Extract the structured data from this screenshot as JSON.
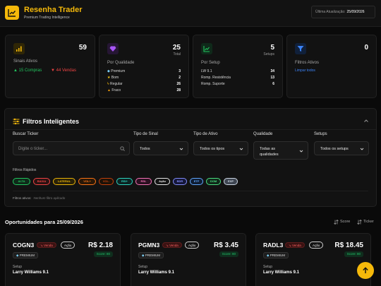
{
  "header": {
    "title": "Resenha Trader",
    "subtitle": "Premium Trading Intelligence",
    "update_label": "Última Atualização:",
    "update_date": "25/09/2026"
  },
  "stats": {
    "signals": {
      "value": "59",
      "title": "Sinais Ativos",
      "buys": "15 Compras",
      "sells": "44 Vendas",
      "icon": "bar-chart-icon"
    },
    "quality": {
      "value": "25",
      "unit": "Total",
      "title": "Por Qualidade",
      "rows": [
        {
          "label": "Premium",
          "count": "3",
          "icon": "gem-icon"
        },
        {
          "label": "Bom",
          "count": "2",
          "icon": "star-icon"
        },
        {
          "label": "Regular",
          "count": "26",
          "icon": "bolt-icon"
        },
        {
          "label": "Fraco",
          "count": "28",
          "icon": "warning-icon"
        }
      ]
    },
    "setup": {
      "value": "5",
      "unit": "Setups",
      "title": "Por Setup",
      "rows": [
        {
          "label": "LW 9.1",
          "count": "34"
        },
        {
          "label": "Romp. Resistência",
          "count": "13"
        },
        {
          "label": "Romp. Suporte",
          "count": "6"
        }
      ]
    },
    "filters": {
      "value": "0",
      "title": "Filtros Ativos",
      "clear_label": "Limpar todos"
    }
  },
  "filters": {
    "title": "Filtros Inteligentes",
    "ticker_label": "Buscar Ticker",
    "ticker_placeholder": "Digite o ticker...",
    "signal_label": "Tipo de Sinal",
    "signal_value": "Todos",
    "asset_label": "Tipo de Ativo",
    "asset_value": "Todos os tipos",
    "quality_label": "Qualidade",
    "quality_value_line1": "Todas as",
    "quality_value_line2": "qualidades",
    "setups_label": "Setups",
    "setups_value": "Todos os setups",
    "quick_label": "Filtros Rápidos",
    "chips": [
      {
        "label": "ALTA",
        "color": "#22c55e",
        "bg": "#0f2a1a"
      },
      {
        "label": "BAIXA",
        "color": "#ef4444",
        "bg": "#2c1212"
      },
      {
        "label": "LATERAL",
        "color": "#eab308",
        "bg": "#2a2208"
      },
      {
        "label": "VOL+",
        "color": "#f97316",
        "bg": "#2a1808"
      },
      {
        "label": "VOL-",
        "color": "#c2410c",
        "bg": "#1d1208"
      },
      {
        "label": "RSI+",
        "color": "#2dd4bf",
        "bg": "#0c2423"
      },
      {
        "label": "RSI-",
        "color": "#f472b6",
        "bg": "#2a1020"
      },
      {
        "label": "Ação",
        "color": "#e5e5e5",
        "bg": "#141414"
      },
      {
        "label": "BDR",
        "color": "#818cf8",
        "bg": "#15173a"
      },
      {
        "label": "ETF",
        "color": "#60a5fa",
        "bg": "#0f1d33"
      },
      {
        "label": "DOM",
        "color": "#4ade80",
        "bg": "#10291a"
      },
      {
        "label": "EXP",
        "color": "#cbd5e1",
        "bg": "#3f4652"
      }
    ],
    "active_label": "Filtros ativos:",
    "active_value": "Nenhum filtro aplicado"
  },
  "opportunities": {
    "title": "Oportunidades para 25/09/2026",
    "sort_score": "Score",
    "sort_ticker": "Ticker",
    "cards": [
      {
        "ticker": "COGN3",
        "side": "Venda",
        "kind": "Ação",
        "quality": "PREMIUM",
        "price": "R$ 2.18",
        "score": "Score: 80",
        "setup_label": "Setup",
        "setup": "Larry Williams 9.1"
      },
      {
        "ticker": "PGMN3",
        "side": "Venda",
        "kind": "Ação",
        "quality": "PREMIUM",
        "price": "R$ 3.45",
        "score": "Score: 80",
        "setup_label": "Setup",
        "setup": "Larry Williams 9.1"
      },
      {
        "ticker": "RADL3",
        "side": "Venda",
        "kind": "Ação",
        "quality": "PREMIUM",
        "price": "R$ 18.45",
        "score": "Score: 80",
        "setup_label": "Setup",
        "setup": "Larry Williams 9.1"
      }
    ]
  },
  "colors": {
    "accent": "#f5b90a",
    "buy": "#22c55e",
    "sell": "#ef4444",
    "link": "#3b82f6"
  }
}
